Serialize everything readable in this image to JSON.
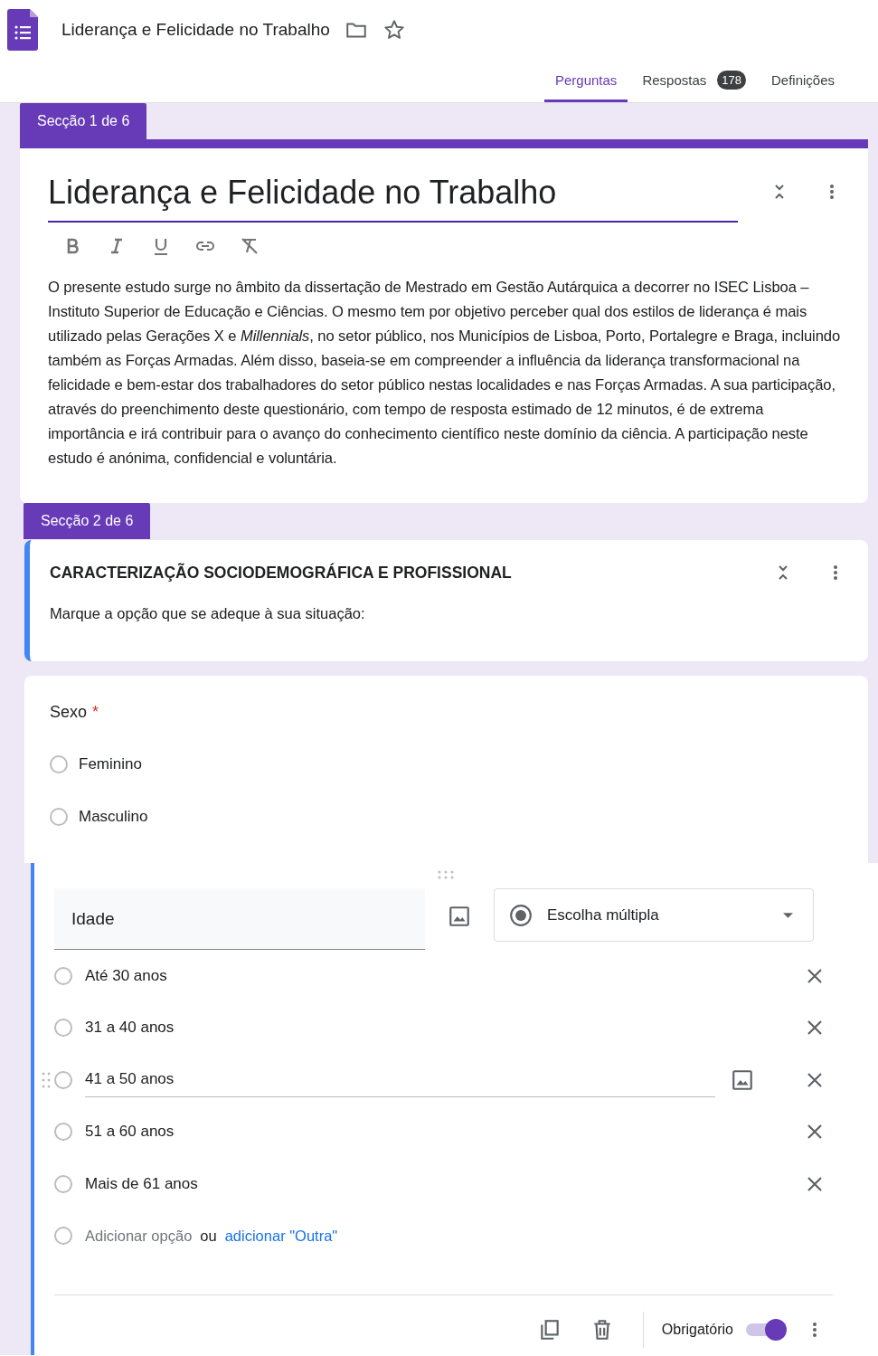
{
  "header": {
    "title": "Liderança e Felicidade no Trabalho"
  },
  "tabs": [
    {
      "label": "Perguntas",
      "selected": true
    },
    {
      "label": "Respostas",
      "selected": false,
      "badge": "178"
    },
    {
      "label": "Definições",
      "selected": false
    }
  ],
  "section1": {
    "tab": "Secção 1 de 6",
    "title": "Liderança e Felicidade no Trabalho",
    "description": "O presente estudo surge no âmbito da dissertação de Mestrado em Gestão Autárquica a decorrer no ISEC Lisboa – Instituto Superior de Educação e Ciências. O mesmo tem por objetivo perceber qual dos estilos de liderança é mais utilizado pelas Gerações X e *Millennials*, no setor público, nos Municípios de Lisboa, Porto, Portalegre e Braga, incluindo também as Forças Armadas. Além disso, baseia-se em compreender a influência da liderança transformacional na felicidade e bem-estar dos trabalhadores do setor público nestas localidades e nas Forças Armadas. A sua participação, através do preenchimento deste questionário, com tempo de resposta estimado de 12 minutos, é de extrema importância e irá contribuir para o avanço do conhecimento científico neste domínio da ciência. A participação neste estudo é anónima, confidencial e voluntária."
  },
  "section2": {
    "tab": "Secção 2 de 6",
    "title": "CARACTERIZAÇÃO SOCIODEMOGRÁFICA E PROFISSIONAL",
    "description": "Marque a opção que se adeque à sua situação:"
  },
  "question_sexo": {
    "title": "Sexo",
    "required": true,
    "required_mark": "*",
    "options": [
      {
        "label": "Feminino",
        "checked": false
      },
      {
        "label": "Masculino",
        "checked": false
      }
    ]
  },
  "question_idade": {
    "title": "Idade",
    "type": "Escolha múltipla",
    "options": [
      {
        "label": "Até 30 anos",
        "checked": false,
        "focused": false
      },
      {
        "label": "31 a 40 anos",
        "checked": false,
        "focused": false
      },
      {
        "label": "41 a 50 anos",
        "checked": false,
        "focused": true
      },
      {
        "label": "51 a 60 anos",
        "checked": false,
        "focused": false
      },
      {
        "label": "Mais de 61 anos",
        "checked": false,
        "focused": false
      }
    ],
    "add_option": "Adicionar opção",
    "add_option_checked": false,
    "or": "ou",
    "add_other": "adicionar \"Outra\"",
    "required_label": "Obrigatório",
    "required_on": true
  }
}
